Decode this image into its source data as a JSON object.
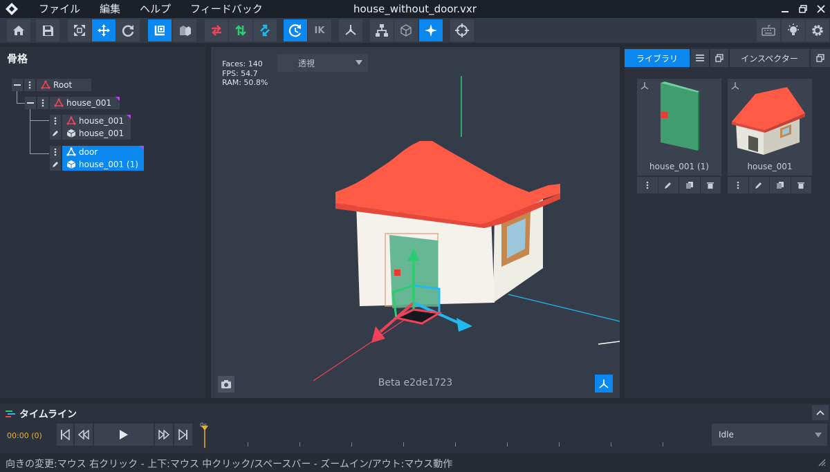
{
  "app": {
    "menus": [
      "ファイル",
      "編集",
      "ヘルプ",
      "フィードバック"
    ],
    "document_title": "house_without_door.vxr"
  },
  "toolbar": {
    "ik_label": "IK",
    "buttons": [
      {
        "name": "home-button",
        "icon": "home-icon",
        "active": false
      },
      {
        "name": "save-button",
        "icon": "save-icon",
        "active": false
      },
      {
        "name": "fit-view-button",
        "icon": "expand-icon",
        "active": false
      },
      {
        "name": "move-tool-button",
        "icon": "move-icon",
        "active": true
      },
      {
        "name": "rotate-tool-button",
        "icon": "rotate-icon",
        "active": false
      },
      {
        "name": "local-space-button",
        "icon": "local-space-icon",
        "active": true
      },
      {
        "name": "world-space-button",
        "icon": "world-space-icon",
        "active": false
      },
      {
        "name": "swap-x-button",
        "icon": "swap-horizontal-icon",
        "active": false
      },
      {
        "name": "swap-y-button",
        "icon": "swap-vertical-icon",
        "active": false
      },
      {
        "name": "swap-z-button",
        "icon": "swap-diagonal-icon",
        "active": false
      },
      {
        "name": "pivot-rotate-button",
        "icon": "pivot-rotate-icon",
        "active": true
      },
      {
        "name": "ik-button",
        "icon": "ik-icon",
        "active": false
      },
      {
        "name": "skeleton-button",
        "icon": "skeleton-icon",
        "active": false
      },
      {
        "name": "hierarchy-button",
        "icon": "hierarchy-icon",
        "active": false
      },
      {
        "name": "cube-button",
        "icon": "cube-icon",
        "active": false
      },
      {
        "name": "sparkle-button",
        "icon": "sparkle-icon",
        "active": true
      },
      {
        "name": "target-button",
        "icon": "crosshair-icon",
        "active": false
      },
      {
        "name": "keyboard-button",
        "icon": "keyboard-icon",
        "active": false
      },
      {
        "name": "light-button",
        "icon": "lightbulb-icon",
        "active": false
      },
      {
        "name": "settings-button",
        "icon": "gear-icon",
        "active": false
      }
    ]
  },
  "skeleton_panel": {
    "title": "骨格",
    "nodes": [
      {
        "label": "Root",
        "type": "bone",
        "selected": false
      },
      {
        "label": "house_001",
        "type": "bone",
        "selected": false
      },
      {
        "label": "house_001",
        "type": "bone",
        "selected": false
      },
      {
        "label": "house_001",
        "type": "mesh",
        "selected": false
      },
      {
        "label": "door",
        "type": "bone",
        "selected": true
      },
      {
        "label": "house_001 (1)",
        "type": "mesh",
        "selected": true
      }
    ]
  },
  "viewport": {
    "stats": {
      "faces": "Faces: 140",
      "fps": "FPS: 54.7",
      "ram": "RAM: 50.8%"
    },
    "view_mode": "透視",
    "build": "Beta e2de1723"
  },
  "right_panel": {
    "tabs": [
      "ライブラリ",
      "インスペクター"
    ],
    "library_items": [
      {
        "label": "house_001 (1)",
        "preview": "door-preview"
      },
      {
        "label": "house_001",
        "preview": "house-preview"
      }
    ]
  },
  "timeline": {
    "title": "タイムライン",
    "current_time": "00:00 (0)",
    "ruler_start": "0s",
    "animation": "Idle"
  },
  "status": {
    "hint": "向きの変更:マウス 右クリック - 上下:マウス 中クリック/スペースバー - ズームイン/アウト:マウス動作"
  },
  "colors": {
    "accent": "#0b88ef",
    "roof": "#ff5a45",
    "door": "#4caf7d",
    "axis_x": "#f0415a",
    "axis_y": "#2ecc71",
    "axis_z": "#22b8f0",
    "time": "#e8b339"
  }
}
